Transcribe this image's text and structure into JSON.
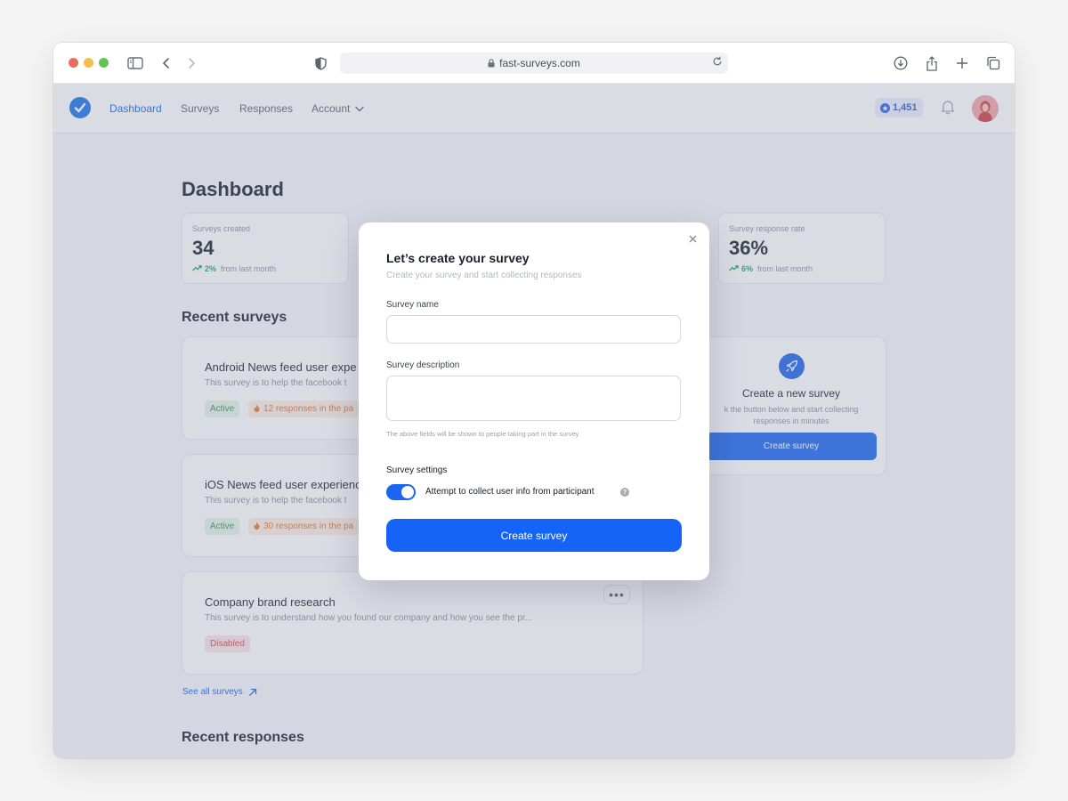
{
  "browser": {
    "url": "fast-surveys.com"
  },
  "nav": {
    "items": [
      {
        "label": "Dashboard"
      },
      {
        "label": "Surveys"
      },
      {
        "label": "Responses"
      },
      {
        "label": "Account"
      }
    ],
    "points": "1,451"
  },
  "dashboard": {
    "title": "Dashboard",
    "stats": [
      {
        "label": "Surveys created",
        "value": "34",
        "delta": "2%",
        "delta_text": "from last month"
      },
      {
        "label": "Survey response rate",
        "value": "36%",
        "delta": "6%",
        "delta_text": "from last month"
      }
    ],
    "recent_surveys_title": "Recent surveys",
    "surveys": [
      {
        "title": "Android News feed user expe",
        "desc": "This survey is to help the facebook t",
        "status": "Active",
        "responses": "12 responses in the pa"
      },
      {
        "title": "iOS News feed user experienc",
        "desc": "This survey is to help the facebook t",
        "status": "Active",
        "responses": "30 responses in the pa"
      },
      {
        "title": "Company brand research",
        "desc": "This survey is to understand how you found our company and how you see the pr...",
        "status": "Disabled",
        "more": "•••"
      }
    ],
    "see_all": "See all surveys",
    "recent_responses_title": "Recent responses",
    "new_survey": {
      "title": "Create a new survey",
      "desc": "k the button below and start collecting responses in minutes",
      "button": "Create survey"
    }
  },
  "modal": {
    "title": "Let’s create your survey",
    "subtitle": "Create your survey and start collecting responses",
    "name_label": "Survey name",
    "name_value": "",
    "description_label": "Survey description",
    "description_value": "",
    "hint": "The above fields will be shown to people taking part in the survey",
    "settings_label": "Survey settings",
    "toggle_label": "Attempt to collect user info from participant",
    "toggle_on": true,
    "help": "?",
    "submit": "Create survey"
  },
  "colors": {
    "accent": "#1a66f0",
    "success": "#2c9a4b",
    "warning": "#e0762b",
    "danger": "#d64848"
  }
}
